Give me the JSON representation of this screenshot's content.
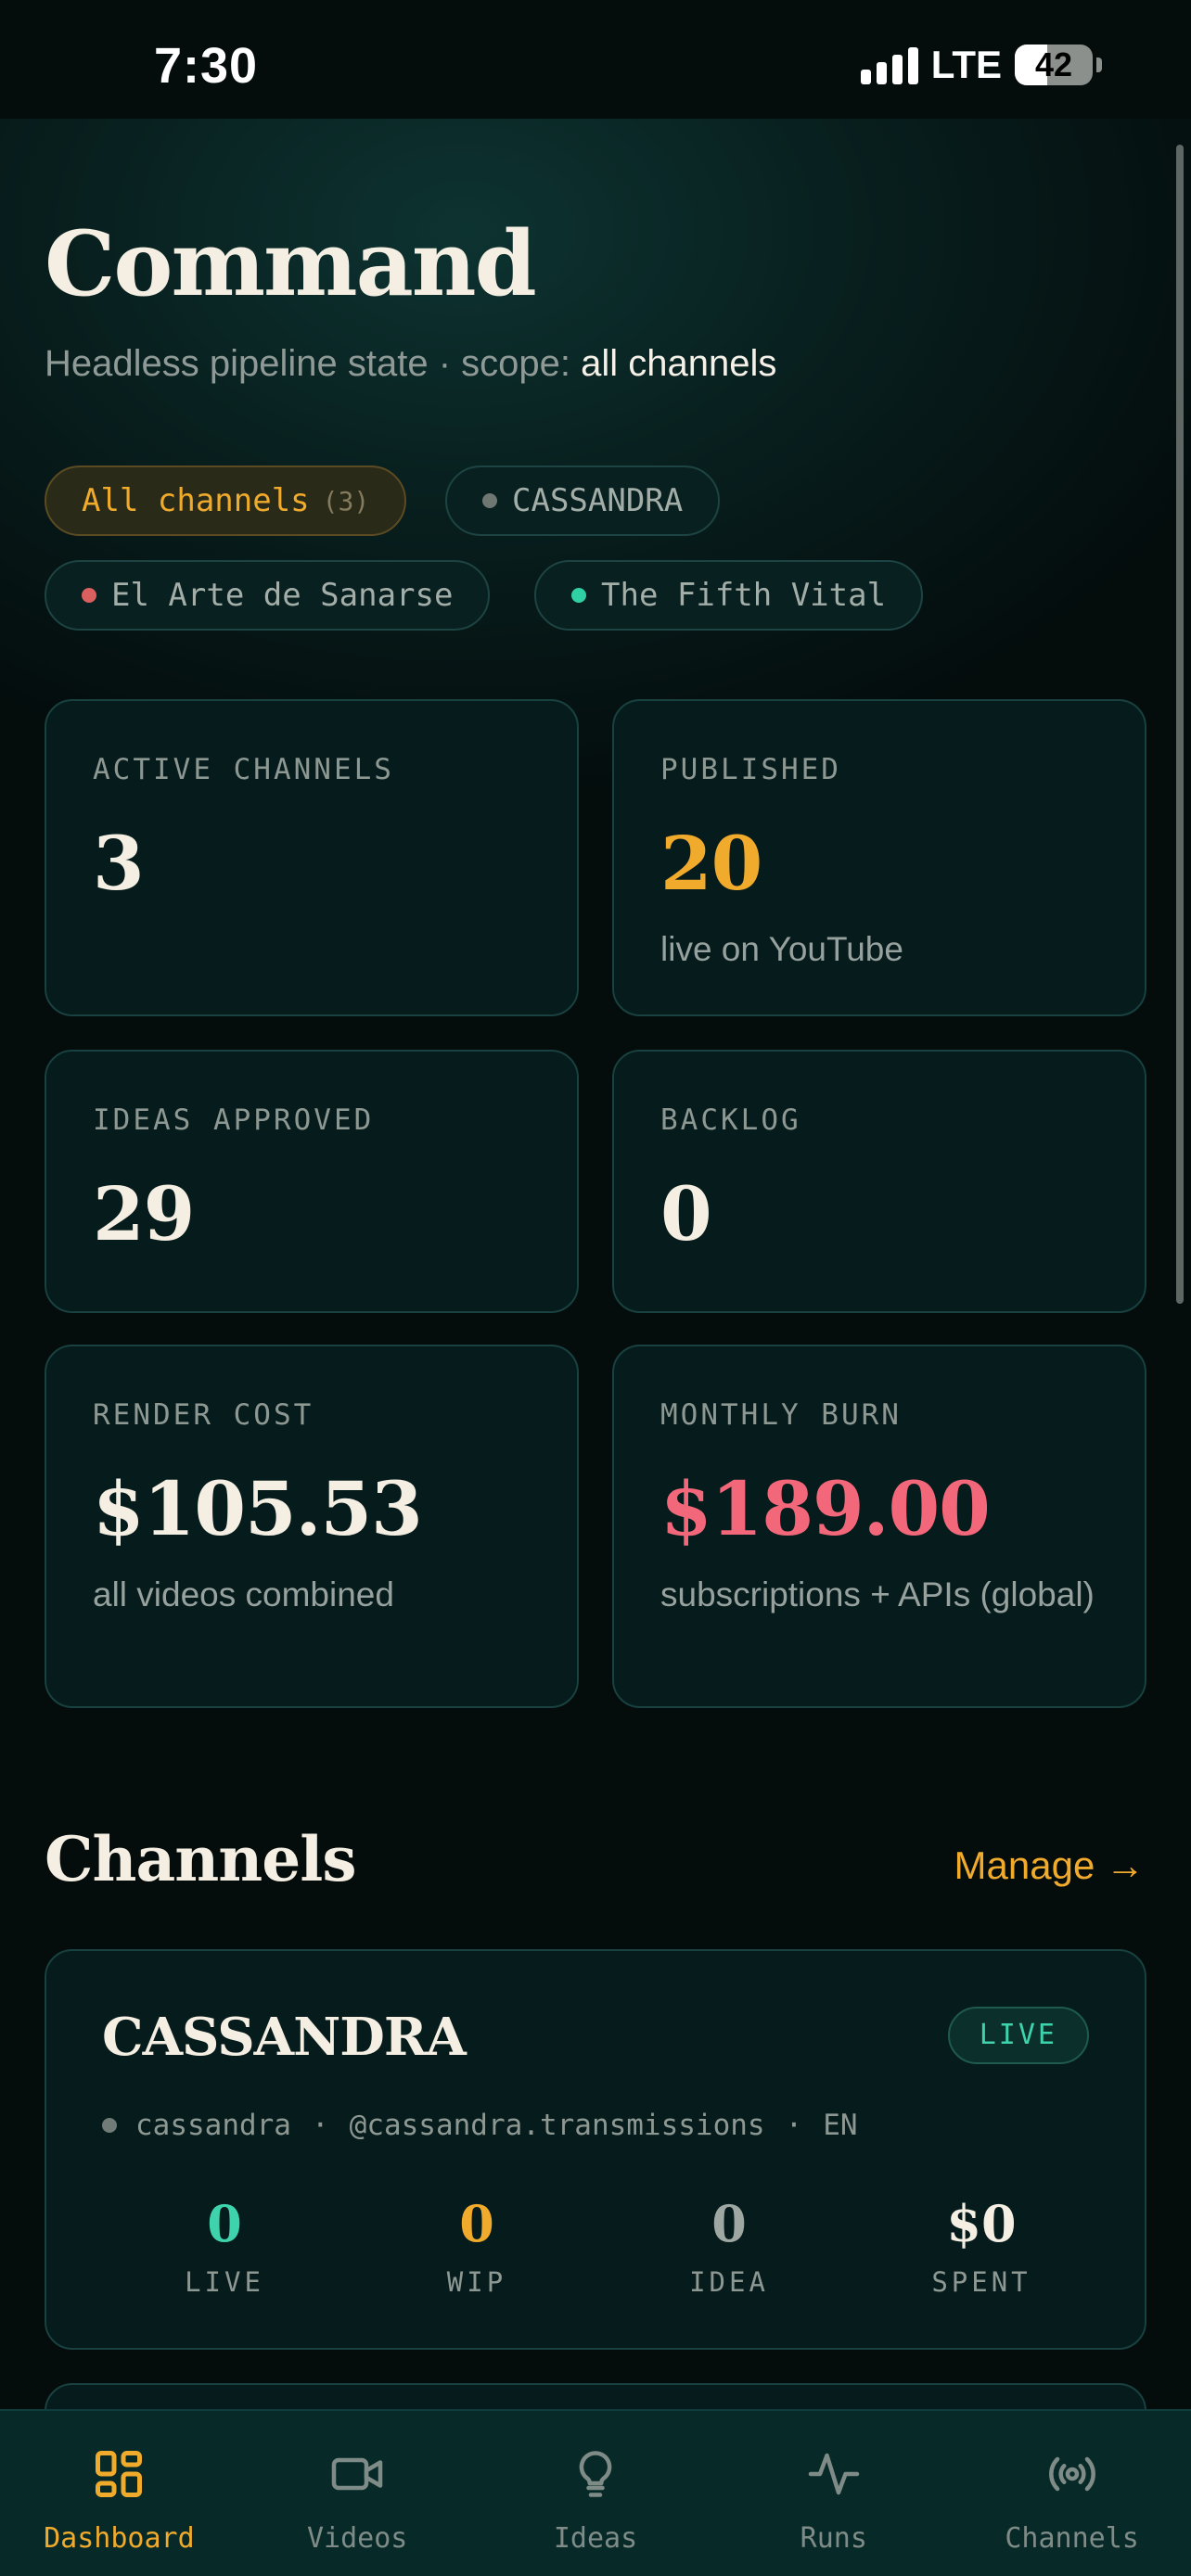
{
  "status_bar": {
    "time": "7:30",
    "network": "LTE",
    "battery": "42",
    "battery_level": 0.42
  },
  "header": {
    "title": "Command",
    "subtitle_prefix": "Headless pipeline state · scope: ",
    "subtitle_scope": "all channels"
  },
  "filters": [
    {
      "label": "All channels",
      "count": "(3)",
      "active": true
    },
    {
      "label": "CASSANDRA",
      "dot_color": "#6f7773"
    },
    {
      "label": "El Arte de Sanarse",
      "dot_color": "#d9605e"
    },
    {
      "label": "The Fifth Vital",
      "dot_color": "#2fd0a4"
    }
  ],
  "stats": {
    "active_channels": {
      "label": "ACTIVE CHANNELS",
      "value": "3"
    },
    "published": {
      "label": "PUBLISHED",
      "value": "20",
      "sub": "live on YouTube",
      "color": "#f0aa2c"
    },
    "ideas_approved": {
      "label": "IDEAS APPROVED",
      "value": "29"
    },
    "backlog": {
      "label": "BACKLOG",
      "value": "0"
    },
    "render_cost": {
      "label": "RENDER COST",
      "value": "$105.53",
      "sub": "all videos combined"
    },
    "monthly_burn": {
      "label": "MONTHLY BURN",
      "value": "$189.00",
      "sub": "subscriptions + APIs (global)",
      "color": "#f2677a"
    }
  },
  "channels_section": {
    "title": "Channels",
    "manage_label": "Manage →",
    "channels": [
      {
        "name": "CASSANDRA",
        "status": "LIVE",
        "slug": "cassandra",
        "handle": "@cassandra.transmissions",
        "lang": "EN",
        "stats": [
          {
            "value": "0",
            "label": "LIVE",
            "color": "#3ed3ac"
          },
          {
            "value": "0",
            "label": "WIP",
            "color": "#f0aa2c"
          },
          {
            "value": "0",
            "label": "IDEA",
            "color": "#9ea7a2"
          },
          {
            "value": "$0",
            "label": "SPENT",
            "color": "#f5efe3"
          }
        ]
      }
    ]
  },
  "tab_bar": [
    {
      "label": "Dashboard",
      "icon": "dashboard-grid-icon",
      "active": true
    },
    {
      "label": "Videos",
      "icon": "video-camera-icon"
    },
    {
      "label": "Ideas",
      "icon": "lightbulb-icon"
    },
    {
      "label": "Runs",
      "icon": "activity-pulse-icon"
    },
    {
      "label": "Channels",
      "icon": "broadcast-icon"
    }
  ],
  "colors": {
    "accent": "#f0aa2c",
    "live": "#3ed3ac",
    "burn": "#f2677a",
    "background": "#040c0c"
  }
}
